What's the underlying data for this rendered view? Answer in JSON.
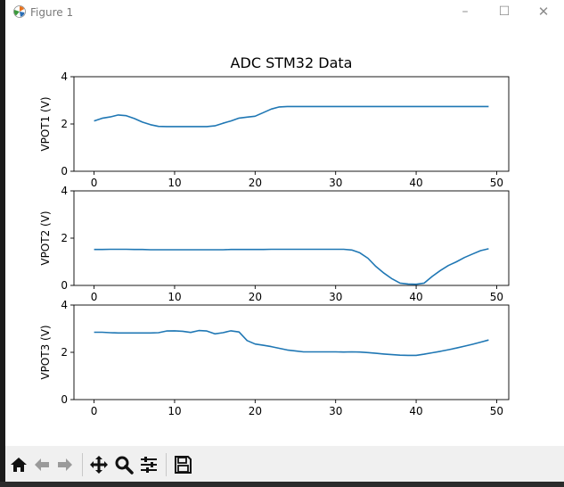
{
  "window": {
    "title": "Figure 1",
    "minimize_glyph": "–",
    "maximize_glyph": "☐",
    "close_glyph": "✕"
  },
  "toolbar": {
    "icons": [
      "home-icon",
      "back-arrow-icon",
      "forward-arrow-icon",
      "pan-icon",
      "zoom-icon",
      "configure-subplots-icon",
      "save-icon"
    ]
  },
  "colors": {
    "line": "#1f77b4"
  },
  "chart_data": {
    "type": "line",
    "title": "ADC STM32 Data",
    "subplots": [
      {
        "ylabel": "VPOT1 (V)",
        "xlim": [
          -2.5,
          51.5
        ],
        "ylim": [
          0,
          4
        ],
        "xticks": [
          0,
          10,
          20,
          30,
          40,
          50
        ],
        "yticks": [
          0,
          2,
          4
        ],
        "x": [
          0,
          1,
          2,
          3,
          4,
          5,
          6,
          7,
          8,
          9,
          10,
          11,
          12,
          13,
          14,
          15,
          16,
          17,
          18,
          19,
          20,
          21,
          22,
          23,
          24,
          25,
          26,
          27,
          28,
          29,
          30,
          31,
          32,
          33,
          34,
          35,
          36,
          37,
          38,
          39,
          40,
          41,
          42,
          43,
          44,
          45,
          46,
          47,
          48,
          49
        ],
        "values": [
          2.13,
          2.24,
          2.3,
          2.38,
          2.35,
          2.23,
          2.08,
          1.97,
          1.9,
          1.89,
          1.89,
          1.89,
          1.89,
          1.89,
          1.89,
          1.92,
          2.03,
          2.13,
          2.25,
          2.29,
          2.33,
          2.48,
          2.63,
          2.72,
          2.74,
          2.74,
          2.74,
          2.74,
          2.74,
          2.74,
          2.74,
          2.74,
          2.74,
          2.74,
          2.74,
          2.74,
          2.74,
          2.74,
          2.74,
          2.74,
          2.74,
          2.74,
          2.74,
          2.74,
          2.74,
          2.74,
          2.74,
          2.74,
          2.74,
          2.74
        ]
      },
      {
        "ylabel": "VPOT2 (V)",
        "xlim": [
          -2.5,
          51.5
        ],
        "ylim": [
          0,
          4
        ],
        "xticks": [
          0,
          10,
          20,
          30,
          40,
          50
        ],
        "yticks": [
          0,
          2,
          4
        ],
        "x": [
          0,
          1,
          2,
          3,
          4,
          5,
          6,
          7,
          8,
          9,
          10,
          11,
          12,
          13,
          14,
          15,
          16,
          17,
          18,
          19,
          20,
          21,
          22,
          23,
          24,
          25,
          26,
          27,
          28,
          29,
          30,
          31,
          32,
          33,
          34,
          35,
          36,
          37,
          38,
          39,
          40,
          41,
          42,
          43,
          44,
          45,
          46,
          47,
          48,
          49
        ],
        "values": [
          1.52,
          1.52,
          1.53,
          1.53,
          1.53,
          1.52,
          1.52,
          1.51,
          1.51,
          1.51,
          1.51,
          1.51,
          1.51,
          1.51,
          1.51,
          1.51,
          1.51,
          1.52,
          1.52,
          1.52,
          1.52,
          1.52,
          1.53,
          1.53,
          1.53,
          1.53,
          1.53,
          1.53,
          1.53,
          1.53,
          1.53,
          1.53,
          1.5,
          1.38,
          1.15,
          0.8,
          0.52,
          0.28,
          0.1,
          0.06,
          0.05,
          0.1,
          0.38,
          0.63,
          0.84,
          1.0,
          1.18,
          1.33,
          1.47,
          1.55
        ]
      },
      {
        "ylabel": "VPOT3 (V)",
        "xlim": [
          -2.5,
          51.5
        ],
        "ylim": [
          0,
          4
        ],
        "xticks": [
          0,
          10,
          20,
          30,
          40,
          50
        ],
        "yticks": [
          0,
          2,
          4
        ],
        "x": [
          0,
          1,
          2,
          3,
          4,
          5,
          6,
          7,
          8,
          9,
          10,
          11,
          12,
          13,
          14,
          15,
          16,
          17,
          18,
          19,
          20,
          21,
          22,
          23,
          24,
          25,
          26,
          27,
          28,
          29,
          30,
          31,
          32,
          33,
          34,
          35,
          36,
          37,
          38,
          39,
          40,
          41,
          42,
          43,
          44,
          45,
          46,
          47,
          48,
          49
        ],
        "values": [
          2.85,
          2.85,
          2.83,
          2.82,
          2.82,
          2.82,
          2.82,
          2.82,
          2.83,
          2.9,
          2.91,
          2.89,
          2.84,
          2.92,
          2.9,
          2.78,
          2.83,
          2.91,
          2.86,
          2.5,
          2.35,
          2.3,
          2.24,
          2.17,
          2.1,
          2.06,
          2.02,
          2.02,
          2.02,
          2.02,
          2.02,
          2.01,
          2.02,
          2.01,
          1.99,
          1.96,
          1.93,
          1.9,
          1.88,
          1.87,
          1.87,
          1.92,
          1.98,
          2.04,
          2.11,
          2.18,
          2.26,
          2.34,
          2.43,
          2.52
        ]
      }
    ]
  }
}
